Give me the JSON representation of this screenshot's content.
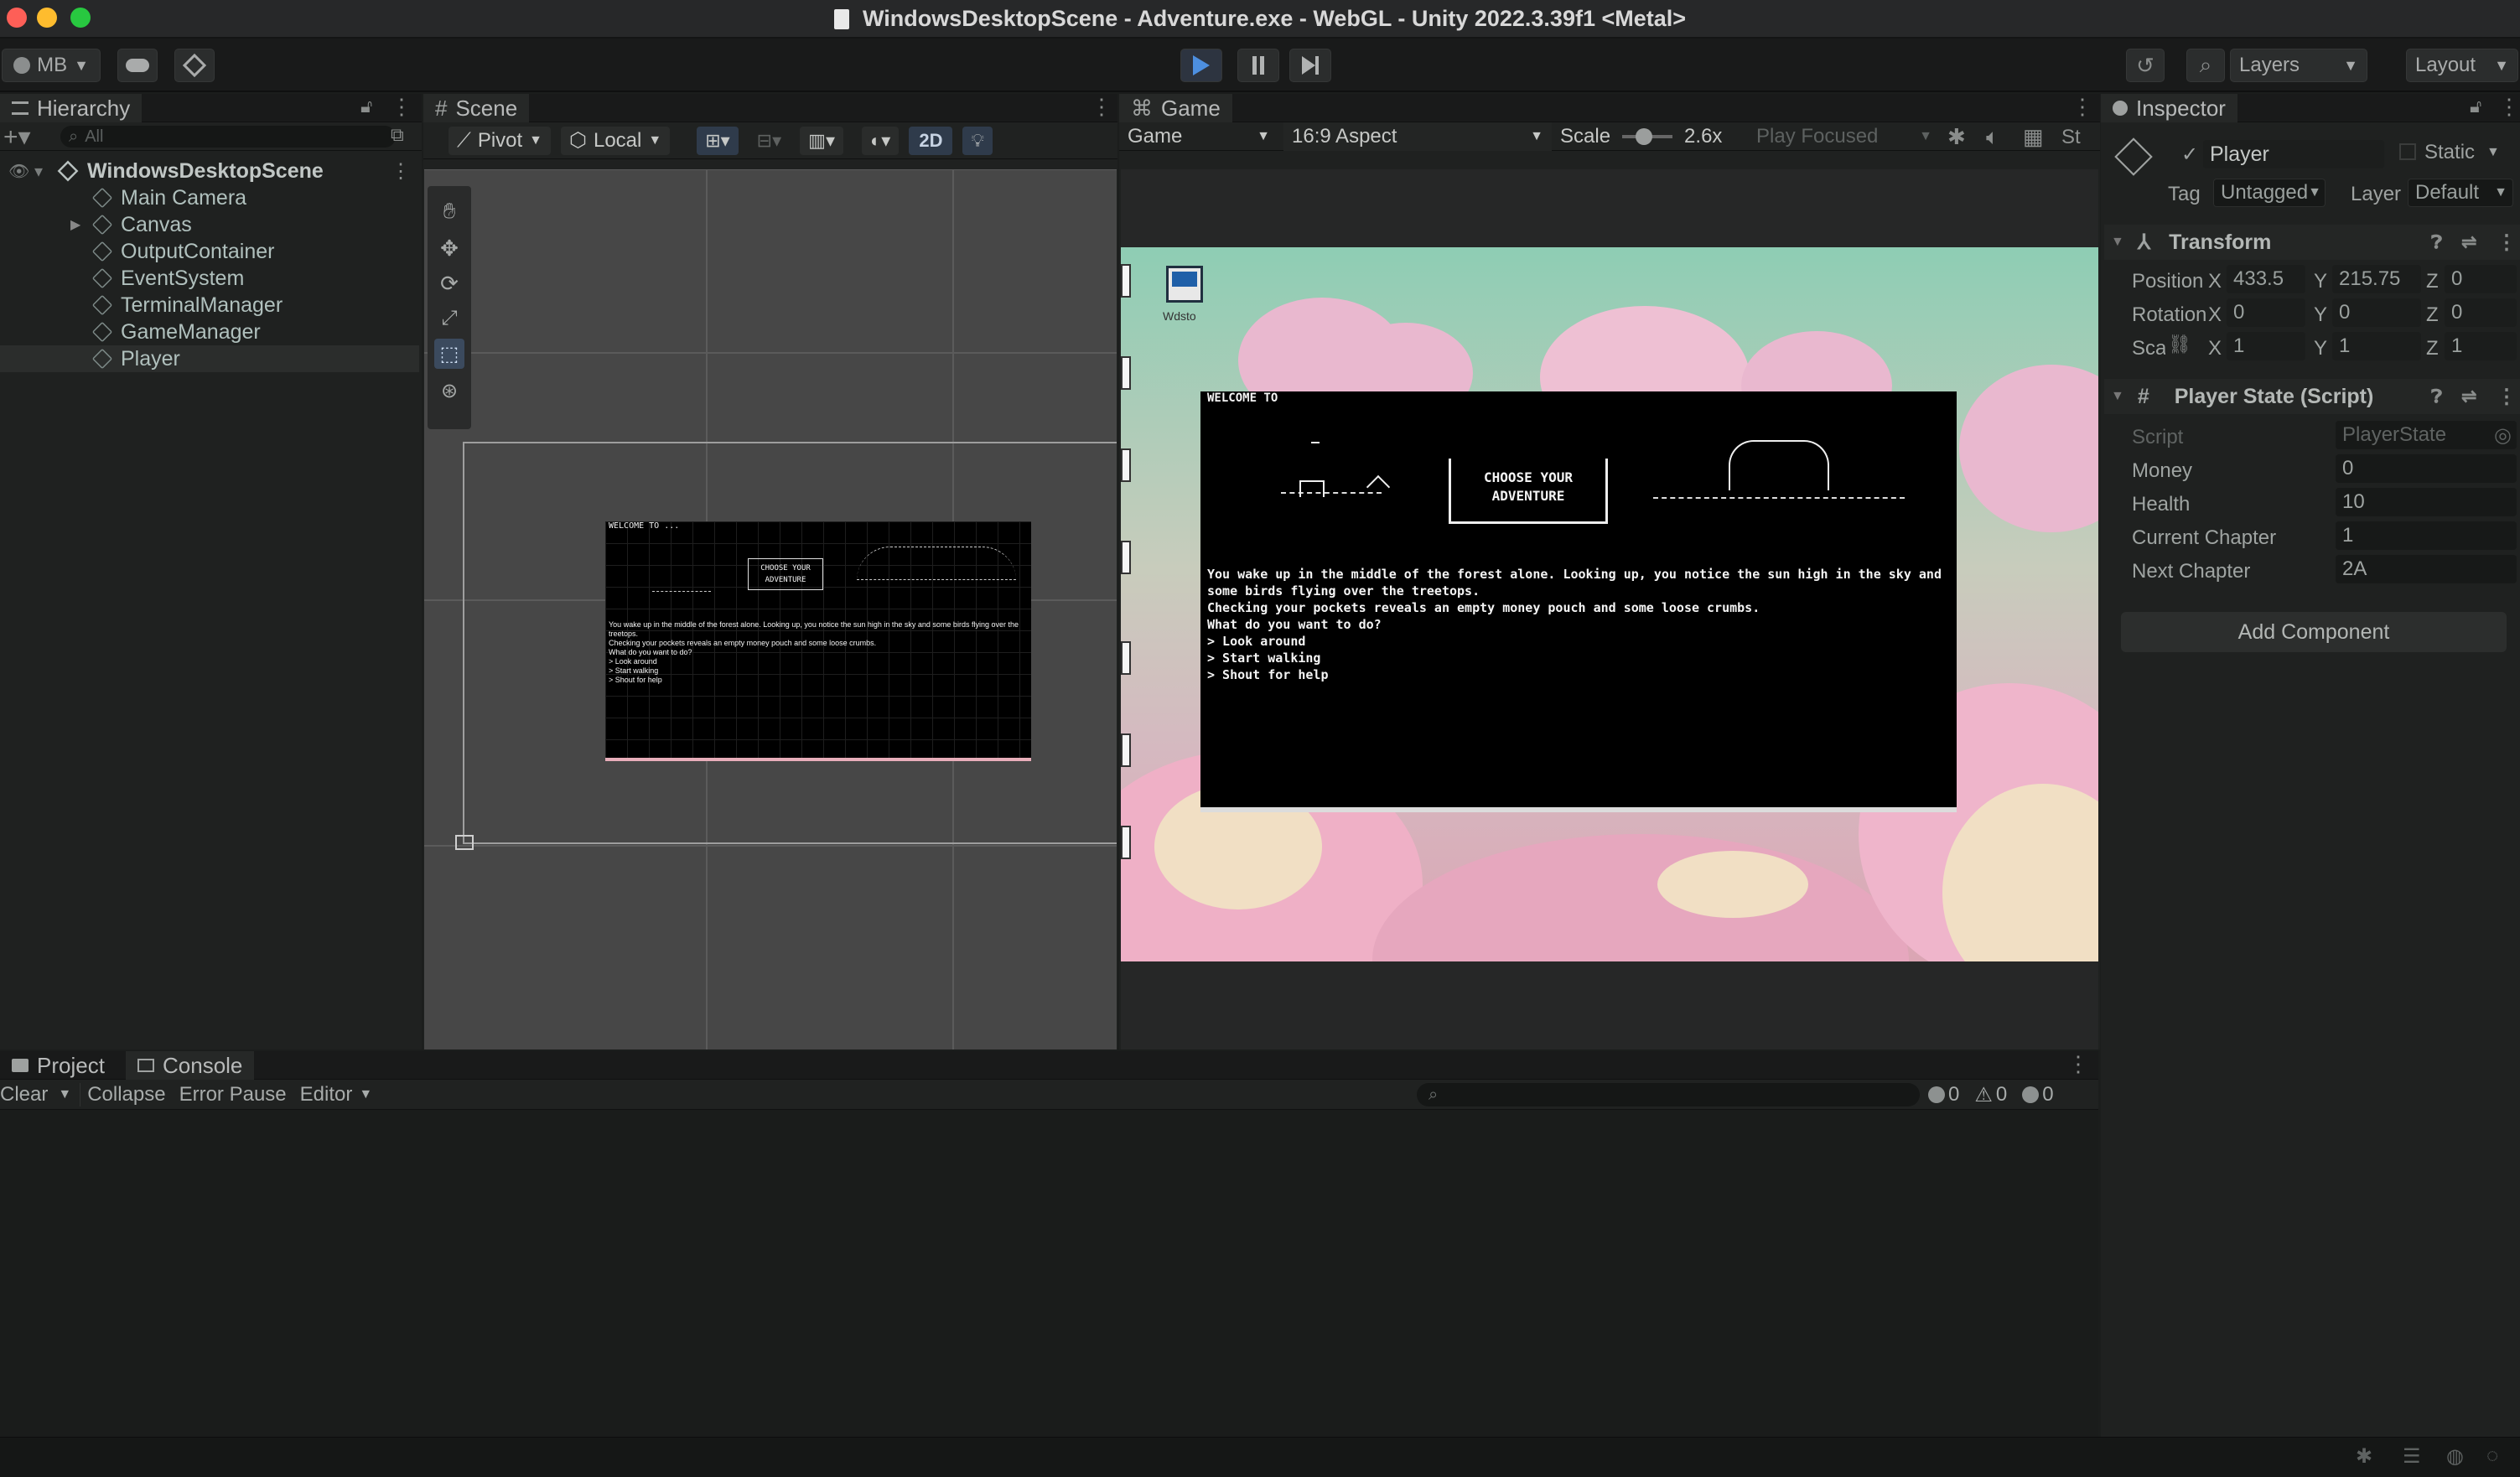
{
  "window": {
    "title": "WindowsDesktopScene - Adventure.exe - WebGL - Unity 2022.3.39f1 <Metal>"
  },
  "toolbar": {
    "account": "MB",
    "layers": "Layers",
    "layout": "Layout"
  },
  "hierarchy": {
    "tab": "Hierarchy",
    "search_placeholder": "All",
    "scene": "WindowsDesktopScene",
    "items": [
      {
        "label": "Main Camera"
      },
      {
        "label": "Canvas"
      },
      {
        "label": "OutputContainer"
      },
      {
        "label": "EventSystem"
      },
      {
        "label": "TerminalManager"
      },
      {
        "label": "GameManager"
      },
      {
        "label": "Player"
      }
    ]
  },
  "scene": {
    "tab": "Scene",
    "pivot": "Pivot",
    "local": "Local",
    "mode_2d": "2D"
  },
  "game": {
    "tab": "Game",
    "display": "Game",
    "aspect": "16:9 Aspect",
    "scale_label": "Scale",
    "scale_value": "2.6x",
    "play_focused": "Play Focused",
    "stats": "St",
    "icon_caption": "Wdsto"
  },
  "terminal": {
    "welcome": "WELCOME TO ...",
    "welcome_game": "WELCOME TO",
    "banner_line1": "CHOOSE YOUR",
    "banner_line2": "ADVENTURE",
    "lines": [
      "You wake up in the middle of the forest alone. Looking up, you notice the sun high in the sky and some birds flying over the treetops.",
      "Checking your pockets reveals an empty money pouch and some loose crumbs.",
      "What do you want to do?",
      "> Look around",
      "> Start walking",
      "> Shout for help"
    ]
  },
  "inspector": {
    "tab": "Inspector",
    "object_name": "Player",
    "static": "Static",
    "tag_label": "Tag",
    "tag_value": "Untagged",
    "layer_label": "Layer",
    "layer_value": "Default",
    "transform": {
      "title": "Transform",
      "position_label": "Position",
      "pos_x": "433.5",
      "pos_y": "215.75",
      "pos_z": "0",
      "rotation_label": "Rotation",
      "rot_x": "0",
      "rot_y": "0",
      "rot_z": "0",
      "scale_label": "Scale",
      "scl_x": "1",
      "scl_y": "1",
      "scl_z": "1"
    },
    "script_component": {
      "title": "Player State (Script)",
      "script_label": "Script",
      "script_value": "PlayerState",
      "props": [
        {
          "label": "Money",
          "value": "0"
        },
        {
          "label": "Health",
          "value": "10"
        },
        {
          "label": "Current Chapter",
          "value": "1"
        },
        {
          "label": "Next Chapter",
          "value": "2A"
        }
      ]
    },
    "add_component": "Add Component"
  },
  "console": {
    "tab_project": "Project",
    "tab_console": "Console",
    "clear": "Clear",
    "collapse": "Collapse",
    "error_pause": "Error Pause",
    "editor": "Editor",
    "info_count": "0",
    "warn_count": "0",
    "error_count": "0"
  },
  "colors": {
    "accent": "#4d8fe0",
    "bg": "#1f2120"
  }
}
